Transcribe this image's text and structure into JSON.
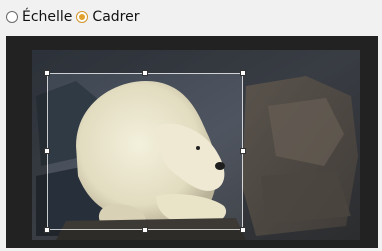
{
  "mode": {
    "options": [
      {
        "label": "Échelle",
        "selected": false
      },
      {
        "label": "Cadrer",
        "selected": true
      }
    ],
    "accent_color": "#e1a22d"
  },
  "crop": {
    "handles": [
      "top-left",
      "top-center",
      "top-right",
      "middle-left",
      "middle-right",
      "bottom-left",
      "bottom-center",
      "bottom-right"
    ]
  }
}
